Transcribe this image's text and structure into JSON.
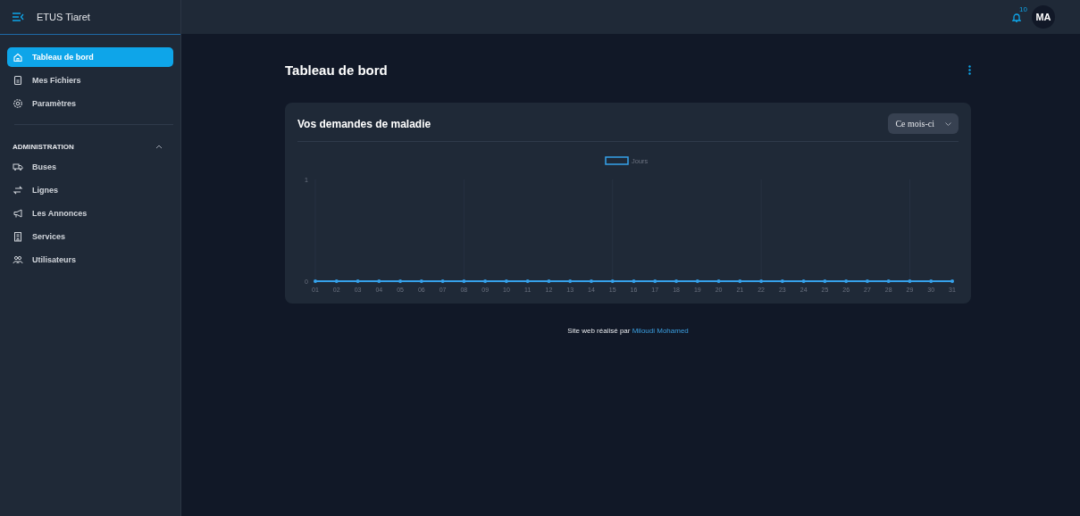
{
  "app": {
    "title": "ETUS Tiaret",
    "notification_count": "10",
    "avatar": "MA"
  },
  "sidebar": {
    "items": [
      {
        "label": "Tableau de bord",
        "selected": true
      },
      {
        "label": "Mes Fichiers",
        "selected": false
      },
      {
        "label": "Paramètres",
        "selected": false
      }
    ],
    "sections": [
      {
        "title": "ADMINISTRATION",
        "expanded": true,
        "items": [
          {
            "label": "Buses",
            "selected": false
          },
          {
            "label": "Lignes",
            "selected": false
          },
          {
            "label": "Les Annonces",
            "selected": false
          },
          {
            "label": "Services",
            "selected": false
          },
          {
            "label": "Utilisateurs",
            "selected": false
          }
        ]
      }
    ]
  },
  "page": {
    "title": "Tableau de bord"
  },
  "card": {
    "title": "Vos demandes de maladie",
    "period": "Ce mois-ci",
    "chart_data": {
      "type": "line",
      "categories": [
        "01",
        "02",
        "03",
        "04",
        "05",
        "06",
        "07",
        "08",
        "09",
        "10",
        "11",
        "12",
        "13",
        "14",
        "15",
        "16",
        "17",
        "18",
        "19",
        "20",
        "21",
        "22",
        "23",
        "24",
        "25",
        "26",
        "27",
        "28",
        "29",
        "30",
        "31"
      ],
      "series": [
        {
          "name": "Jours",
          "color": "#36a2eb",
          "values": [
            0,
            0,
            0,
            0,
            0,
            0,
            0,
            0,
            0,
            0,
            0,
            0,
            0,
            0,
            0,
            0,
            0,
            0,
            0,
            0,
            0,
            0,
            0,
            0,
            0,
            0,
            0,
            0,
            0,
            0,
            0
          ]
        }
      ],
      "ylim": [
        0,
        1
      ],
      "yticks": [
        0,
        1
      ],
      "grid": true
    }
  },
  "footer": {
    "text": "Site web réalisé par",
    "link": "Miloudi Mohamed"
  }
}
